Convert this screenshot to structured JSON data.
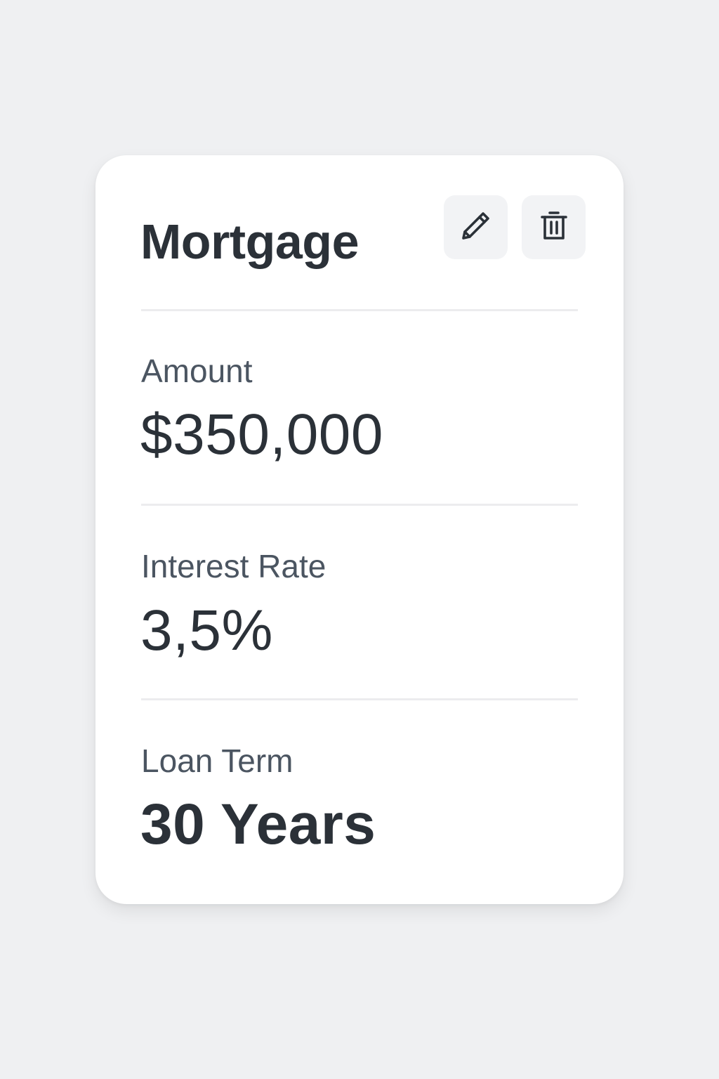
{
  "card": {
    "title": "Mortgage",
    "actions": {
      "edit_icon": "pencil-icon",
      "delete_icon": "trash-icon"
    },
    "fields": [
      {
        "label": "Amount",
        "value": "$350,000"
      },
      {
        "label": "Interest Rate",
        "value": "3,5%"
      },
      {
        "label": "Loan Term",
        "value": "30 Years"
      }
    ]
  },
  "colors": {
    "background": "#eff0f2",
    "card": "#ffffff",
    "text_primary": "#2b3138",
    "text_secondary": "#4b5561",
    "button_bg": "#f2f3f5",
    "divider": "#ececee"
  }
}
